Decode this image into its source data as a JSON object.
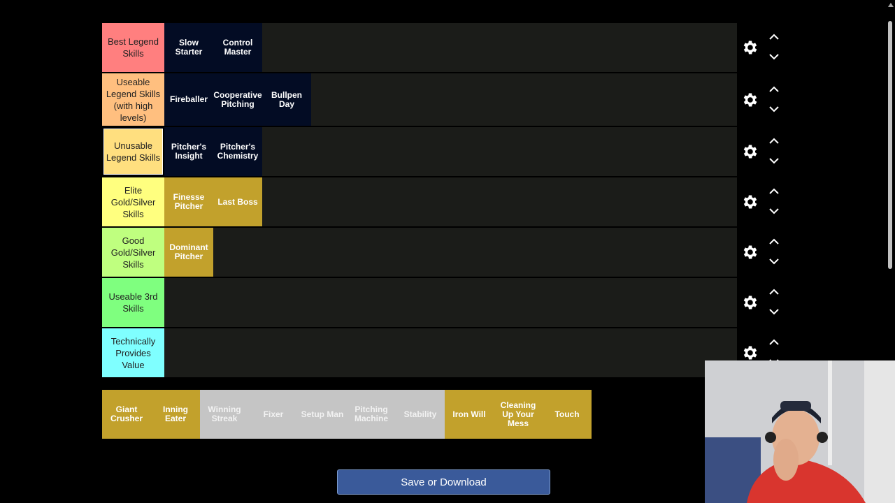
{
  "tiers": [
    {
      "label": "Best Legend Skills",
      "color": "#ff7f7f",
      "items": [
        {
          "text": "Slow Starter",
          "style": "navy"
        },
        {
          "text": "Control Master",
          "style": "navy"
        }
      ]
    },
    {
      "label": "Useable Legend Skills (with high levels)",
      "color": "#ffbf7f",
      "items": [
        {
          "text": "Fireballer",
          "style": "navy"
        },
        {
          "text": "Cooperative Pitching",
          "style": "navy"
        },
        {
          "text": "Bullpen Day",
          "style": "navy"
        }
      ]
    },
    {
      "label": "Unusable Legend Skills",
      "color": "#ffdf7f",
      "items": [
        {
          "text": "Pitcher's Insight",
          "style": "navy"
        },
        {
          "text": "Pitcher's Chemistry",
          "style": "navy"
        }
      ]
    },
    {
      "label": "Elite Gold/Silver Skills",
      "color": "#ffff7f",
      "items": [
        {
          "text": "Finesse Pitcher",
          "style": "gold"
        },
        {
          "text": "Last Boss",
          "style": "gold"
        }
      ]
    },
    {
      "label": "Good Gold/Silver Skills",
      "color": "#bfff7f",
      "items": [
        {
          "text": "Dominant Pitcher",
          "style": "gold"
        }
      ]
    },
    {
      "label": "Useable 3rd Skills",
      "color": "#7fff7f",
      "items": []
    },
    {
      "label": "Technically Provides Value",
      "color": "#7fffff",
      "items": []
    }
  ],
  "unranked": [
    {
      "text": "Giant Crusher",
      "style": "gold"
    },
    {
      "text": "Inning Eater",
      "style": "gold"
    },
    {
      "text": "Winning Streak",
      "style": "silver"
    },
    {
      "text": "Fixer",
      "style": "silver"
    },
    {
      "text": "Setup Man",
      "style": "silver"
    },
    {
      "text": "Pitching Machine",
      "style": "silver"
    },
    {
      "text": "Stability",
      "style": "silver"
    },
    {
      "text": "Iron Will",
      "style": "gold"
    },
    {
      "text": "Cleaning Up Your Mess",
      "style": "gold"
    },
    {
      "text": "Touch",
      "style": "gold"
    }
  ],
  "save_button_label": "Save or Download",
  "icons": {
    "settings": "gear-icon",
    "move_up": "chevron-up-icon",
    "move_down": "chevron-down-icon"
  }
}
